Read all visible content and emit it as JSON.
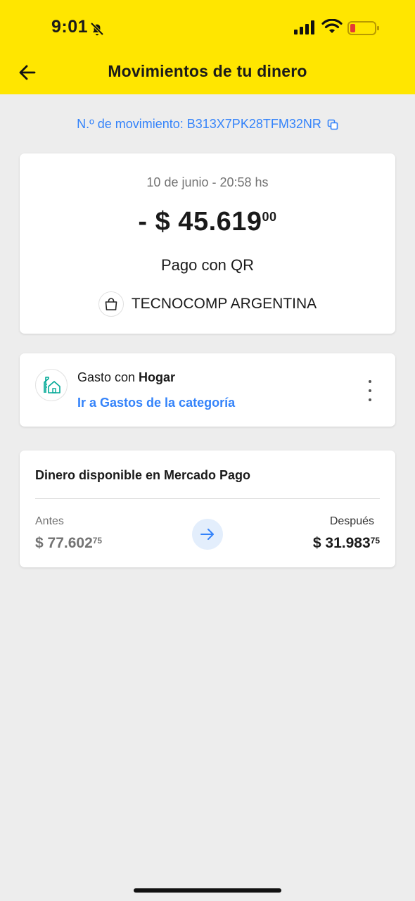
{
  "status_bar": {
    "time": "9:01"
  },
  "header": {
    "title": "Movimientos de tu dinero"
  },
  "movement": {
    "id_text": "N.º de movimiento: B313X7PK28TFM32NR"
  },
  "transaction": {
    "date": "10 de junio - 20:58 hs",
    "amount_main": "- $ 45.619",
    "amount_cents": "00",
    "type": "Pago con QR",
    "merchant": "TECNOCOMP ARGENTINA"
  },
  "category": {
    "prefix": "Gasto con ",
    "name": "Hogar",
    "link": "Ir a Gastos de la categoría"
  },
  "balance": {
    "title": "Dinero disponible en Mercado Pago",
    "before_label": "Antes",
    "before_main": "$ 77.602",
    "before_cents": "75",
    "after_label": "Después",
    "after_main": "$ 31.983",
    "after_cents": "75"
  },
  "colors": {
    "header_bg": "#ffe600",
    "link_blue": "#3483fa",
    "category_teal": "#00a896",
    "page_bg": "#ededed"
  },
  "icons": {
    "back": "arrow-left-icon",
    "copy": "copy-icon",
    "merchant": "shopping-bag-icon",
    "category": "home-icon",
    "menu": "more-vertical-icon",
    "transition": "arrow-right-icon"
  }
}
